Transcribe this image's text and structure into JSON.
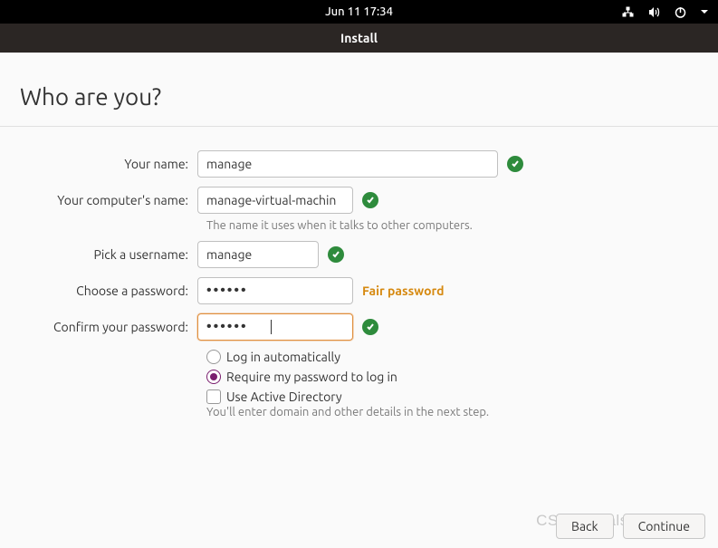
{
  "topbar": {
    "datetime": "Jun 11  17:34"
  },
  "window": {
    "title": "Install"
  },
  "heading": "Who are you?",
  "form": {
    "name": {
      "label": "Your name:",
      "value": "manage"
    },
    "computer": {
      "label": "Your computer's name:",
      "value": "manage-virtual-machin",
      "hint": "The name it uses when it talks to other computers."
    },
    "username": {
      "label": "Pick a username:",
      "value": "manage"
    },
    "password": {
      "label": "Choose a password:",
      "value": "••••••",
      "strength": "Fair password"
    },
    "confirm": {
      "label": "Confirm your password:",
      "value": "••••••"
    },
    "login_auto": "Log in automatically",
    "login_pwd": "Require my password to log in",
    "use_ad": "Use Active Directory",
    "ad_hint": "You'll enter domain and other details in the next step."
  },
  "buttons": {
    "back": "Back",
    "continue": "Continue"
  },
  "watermark": "CSDN @false_or_true"
}
